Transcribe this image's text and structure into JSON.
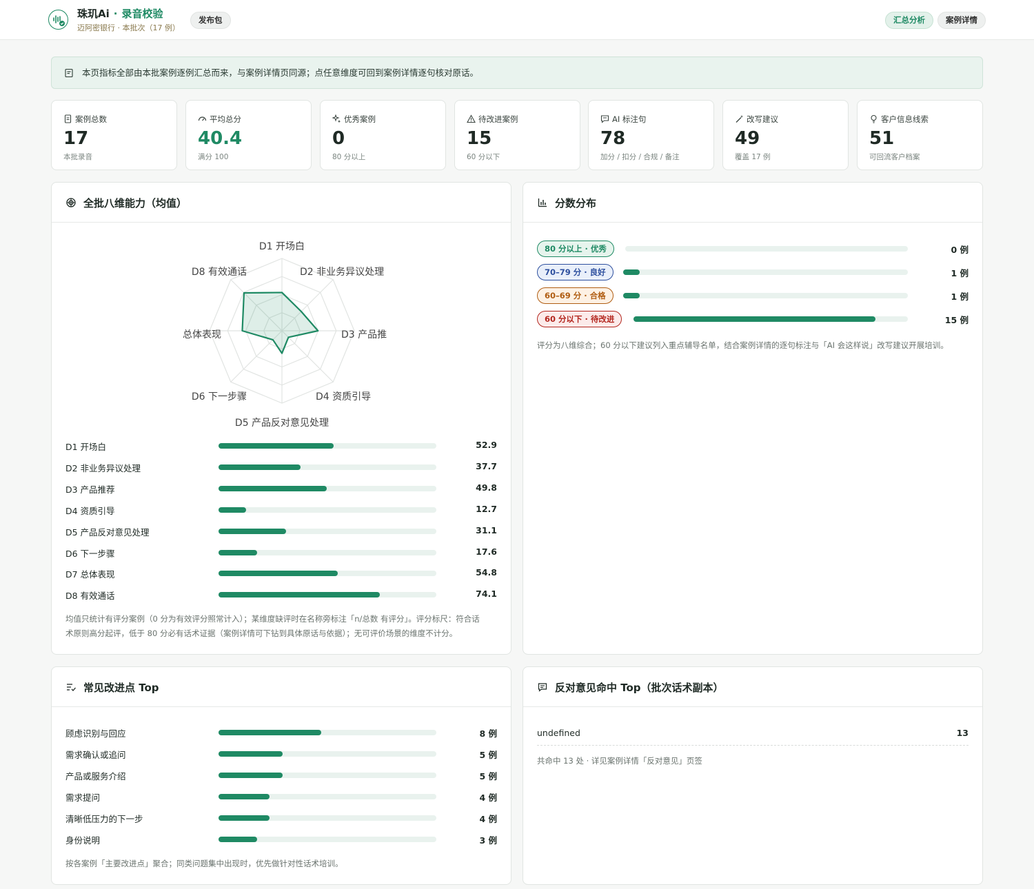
{
  "header": {
    "brand": "珠玑Ai",
    "product": "录音校验",
    "bank": "迈阿密银行",
    "batch": "本批次（17 例）",
    "publish_label": "发布包",
    "tabs": [
      {
        "label": "汇总分析",
        "active": true
      },
      {
        "label": "案例详情",
        "active": false
      }
    ]
  },
  "banner": {
    "text": "本页指标全部由本批案例逐例汇总而来，与案例详情页同源；点任意维度可回到案例详情逐句核对原话。",
    "icon": "note-icon"
  },
  "stats": [
    {
      "icon": "doc-icon",
      "label": "案例总数",
      "value": "17",
      "note": "本批录音",
      "accent": false
    },
    {
      "icon": "gauge-icon",
      "label": "平均总分",
      "value": "40.4",
      "note": "满分 100",
      "accent": true
    },
    {
      "icon": "sparkle-icon",
      "label": "优秀案例",
      "value": "0",
      "note": "80 分以上",
      "accent": false
    },
    {
      "icon": "warning-icon",
      "label": "待改进案例",
      "value": "15",
      "note": "60 分以下",
      "accent": false
    },
    {
      "icon": "comment-icon",
      "label": "AI 标注句",
      "value": "78",
      "note": "加分 / 扣分 / 合规 / 备注",
      "accent": false
    },
    {
      "icon": "wand-icon",
      "label": "改写建议",
      "value": "49",
      "note": "覆盖 17 例",
      "accent": false
    },
    {
      "icon": "bulb-icon",
      "label": "客户信息线索",
      "value": "51",
      "note": "可回流客户档案",
      "accent": false
    }
  ],
  "dimensions_card": {
    "title": "全批八维能力（均值）",
    "radar_labels": [
      "D1 开场白",
      "D2 非业务异议处理",
      "D3 产品推",
      "D4 资质引导",
      "D5 产品反对意见处理",
      "D6 下一步骤",
      "总体表现",
      "D8 有效通话"
    ],
    "rows": [
      {
        "name": "D1 开场白",
        "value": 52.9
      },
      {
        "name": "D2 非业务异议处理",
        "value": 37.7
      },
      {
        "name": "D3 产品推荐",
        "value": 49.8
      },
      {
        "name": "D4 资质引导",
        "value": 12.7
      },
      {
        "name": "D5 产品反对意见处理",
        "value": 31.1
      },
      {
        "name": "D6 下一步骤",
        "value": 17.6
      },
      {
        "name": "D7 总体表现",
        "value": 54.8
      },
      {
        "name": "D8 有效通话",
        "value": 74.1
      }
    ],
    "footnote_1": "均值只统计有评分案例（0 分为有效评分照常计入）；某维度缺评时在名称旁标注「n/总数 有评分」。评分标尺：符合话",
    "footnote_2": "术原则高分起评，低于 80 分必有话术证据（案例详情可下钻到具体原话与依据）；无可评价场景的维度不计分。"
  },
  "distribution_card": {
    "title": "分数分布",
    "rows": [
      {
        "label": "80 分以上 · 优秀",
        "count": 0,
        "count_label": "0 例",
        "tone": "green"
      },
      {
        "label": "70–79 分 · 良好",
        "count": 1,
        "count_label": "1 例",
        "tone": "blue"
      },
      {
        "label": "60–69 分 · 合格",
        "count": 1,
        "count_label": "1 例",
        "tone": "orange"
      },
      {
        "label": "60 分以下 · 待改进",
        "count": 15,
        "count_label": "15 例",
        "tone": "red"
      }
    ],
    "total": 17,
    "footnote": "评分为八维综合；60 分以下建议列入重点辅导名单，结合案例详情的逐句标注与「AI 会这样说」改写建议开展培训。"
  },
  "improvements_card": {
    "title": "常见改进点 Top",
    "max": 17,
    "rows": [
      {
        "name": "顾虑识别与回应",
        "count": 8,
        "count_label": "8 例"
      },
      {
        "name": "需求确认或追问",
        "count": 5,
        "count_label": "5 例"
      },
      {
        "name": "产品或服务介绍",
        "count": 5,
        "count_label": "5 例"
      },
      {
        "name": "需求提问",
        "count": 4,
        "count_label": "4 例"
      },
      {
        "name": "清晰低压力的下一步",
        "count": 4,
        "count_label": "4 例"
      },
      {
        "name": "身份说明",
        "count": 3,
        "count_label": "3 例"
      }
    ],
    "footnote": "按各案例「主要改进点」聚合；同类问题集中出现时，优先做针对性话术培训。"
  },
  "objections_card": {
    "title": "反对意见命中 Top（批次话术副本）",
    "rows": [
      {
        "name": "undefined",
        "count": "13"
      }
    ],
    "footnote": "共命中 13 处 · 详见案例详情「反对意见」页签"
  },
  "colors": {
    "accent": "#1f8a64",
    "track": "#e9f2ee"
  }
}
